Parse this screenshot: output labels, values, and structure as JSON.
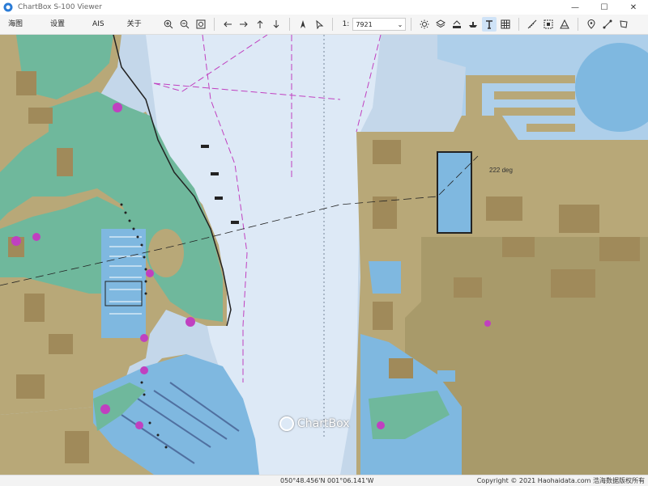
{
  "window": {
    "title": "ChartBox S-100 Viewer",
    "minimize_glyph": "—",
    "maximize_glyph": "☐",
    "close_glyph": "✕"
  },
  "menu": {
    "items": [
      {
        "label": "海图"
      },
      {
        "label": "设置"
      },
      {
        "label": "AIS"
      },
      {
        "label": "关于"
      }
    ]
  },
  "toolbar": {
    "scale_prefix": "1:",
    "scale_value": "7921",
    "scale_arrow": "⌄",
    "icons": [
      "zoom-in-icon",
      "zoom-out-icon",
      "zoom-extent-icon",
      "arrow-left-icon",
      "arrow-right-icon",
      "arrow-up-icon",
      "arrow-down-icon",
      "north-up-icon",
      "course-up-icon",
      "day-night-icon",
      "layers-icon",
      "depth-icon",
      "vessel-icon",
      "text-icon",
      "grid-icon",
      "measure-icon",
      "area-select-icon",
      "chart-select-icon",
      "waypoint-icon",
      "route-icon",
      "polygon-icon"
    ]
  },
  "chart": {
    "bearing_label": "222 deg",
    "watermark": "ChartBox",
    "colors": {
      "land": "#b8a878",
      "land_dark": "#a89a6a",
      "intertidal": "#6fb89c",
      "shallow": "#7fb8e0",
      "medium": "#aecfea",
      "deep": "#dde9f6",
      "channel": "#c4d7ea",
      "boundary": "#c040c0",
      "building": "#a08a5a"
    }
  },
  "status": {
    "coords": "050°48.456'N   001°06.141'W",
    "copyright": "Copyright © 2021 Haohaidata.com 浩海数据版权所有"
  }
}
